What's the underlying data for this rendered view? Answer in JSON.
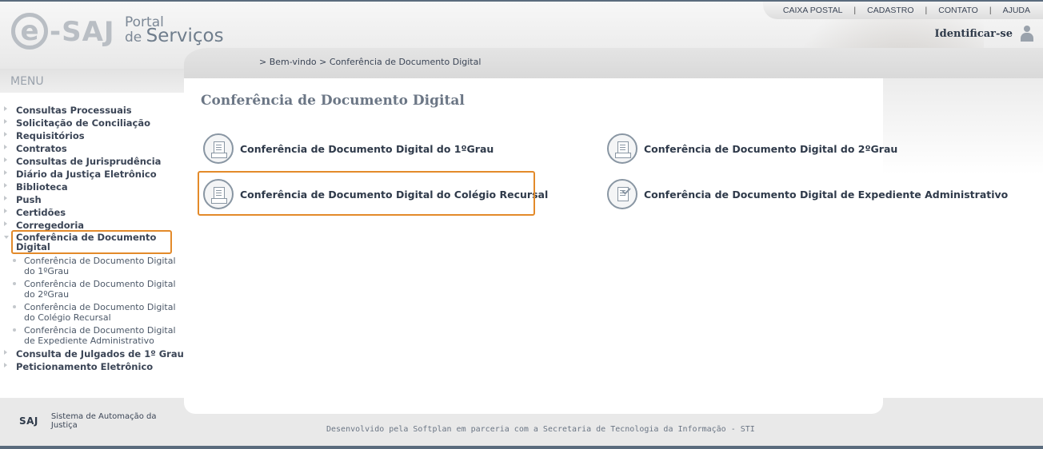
{
  "header": {
    "logo_e": "e",
    "logo_saj": "-SAJ",
    "logo_portal_line1": "Portal",
    "logo_portal_de": "de",
    "logo_portal_servicos": "Serviços",
    "top_links": [
      "CAIXA POSTAL",
      "CADASTRO",
      "CONTATO",
      "AJUDA"
    ],
    "top_separator": "|",
    "login_label": "Identificar-se",
    "user_icon": "user-icon"
  },
  "breadcrumb": "> Bem-vindo > Conferência de Documento Digital",
  "menu": {
    "title": "MENU",
    "items_before": [
      "Consultas Processuais",
      "Solicitação de Conciliação",
      "Requisitórios",
      "Contratos",
      "Consultas de Jurisprudência",
      "Diário da Justiça Eletrônico",
      "Biblioteca",
      "Push",
      "Certidões",
      "Corregedoria"
    ],
    "open_item": "Conferência de Documento Digital",
    "sub_items": [
      "Conferência de Documento Digital do 1ºGrau",
      "Conferência de Documento Digital do 2ºGrau",
      "Conferência de Documento Digital do Colégio Recursal",
      "Conferência de Documento Digital de Expediente Administrativo"
    ],
    "items_after": [
      "Consulta de Julgados de 1º Grau",
      "Peticionamento Eletrônico"
    ]
  },
  "main": {
    "title": "Conferência de Documento Digital",
    "options": [
      {
        "label": "Conferência de Documento Digital do 1ºGrau",
        "icon": "document-certificate-icon"
      },
      {
        "label": "Conferência de Documento Digital do 2ºGrau",
        "icon": "document-certificate-icon"
      },
      {
        "label": "Conferência de Documento Digital do Colégio Recursal",
        "icon": "document-certificate-icon"
      },
      {
        "label": "Conferência de Documento Digital de Expediente Administrativo",
        "icon": "document-check-icon"
      }
    ]
  },
  "footer": {
    "saj_mini": "SAJ",
    "saj_text": "Sistema de Automação da Justiça",
    "credit": "Desenvolvido pela Softplan em parceria com a Secretaria de Tecnologia da Informação - STI"
  },
  "colors": {
    "highlight": "#e38a2a",
    "text_dark": "#2f3a4a",
    "frame": "#5a6b7d"
  }
}
